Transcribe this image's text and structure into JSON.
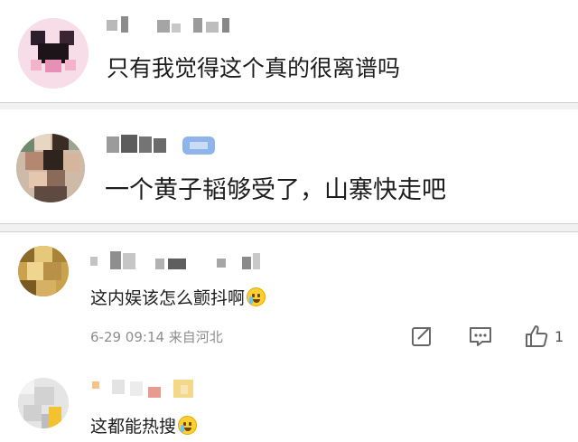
{
  "comments": [
    {
      "text": "只有我觉得这个真的很离谱吗"
    },
    {
      "text": "一个黄子韬够受了，山寨快走吧"
    },
    {
      "text": "这内娱该怎么颤抖啊",
      "emoji": "crying-emoji",
      "meta": "6-29 09:14  来自河北",
      "likes": "1"
    },
    {
      "text": "这都能热搜",
      "emoji": "laughing-emoji"
    }
  ],
  "actions": {
    "share_icon": "share-icon",
    "reply_icon": "comment-icon",
    "like_icon": "thumbs-up-icon"
  },
  "colors": {
    "accent_badge": "#8fb4ea",
    "separator": "#f1f1f1",
    "meta_text": "#8e8e8e",
    "emoji_yellow": "#ffcf33"
  }
}
